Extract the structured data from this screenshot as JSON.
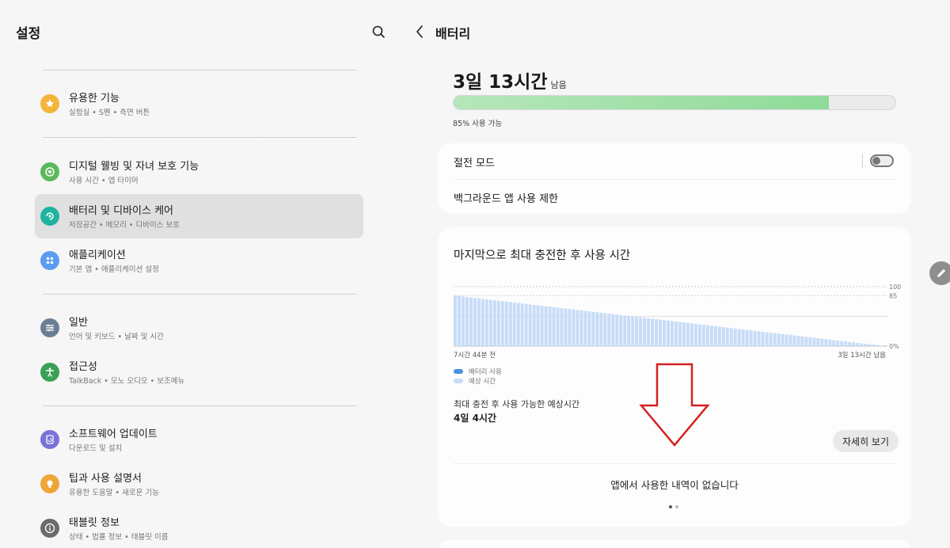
{
  "left": {
    "title": "설정",
    "items": [
      {
        "title": "유용한 기능",
        "sub": "실험실 • S펜 • 측면 버튼",
        "icon": "star-icon",
        "color": "#f3b63a"
      },
      {
        "title": "디지털 웰빙 및 자녀 보호 기능",
        "sub": "사용 시간 • 앱 타이머",
        "icon": "heart-icon",
        "color": "#5cb85c"
      },
      {
        "title": "배터리 및 디바이스 케어",
        "sub": "저장공간 • 메모리 • 디바이스 보호",
        "icon": "device-care-icon",
        "color": "#20b3a0"
      },
      {
        "title": "애플리케이션",
        "sub": "기본 앱 • 애플리케이션 설정",
        "icon": "apps-icon",
        "color": "#5b9bf0"
      },
      {
        "title": "일반",
        "sub": "언어 및 키보드 • 날짜 및 시간",
        "icon": "sliders-icon",
        "color": "#6b7f94"
      },
      {
        "title": "접근성",
        "sub": "TalkBack • 모노 오디오 • 보조메뉴",
        "icon": "accessibility-icon",
        "color": "#3aa055"
      },
      {
        "title": "소프트웨어 업데이트",
        "sub": "다운로드 및 설치",
        "icon": "update-icon",
        "color": "#7a72d8"
      },
      {
        "title": "팁과 사용 설명서",
        "sub": "유용한 도움말 • 새로운 기능",
        "icon": "bulb-icon",
        "color": "#f0a53a"
      },
      {
        "title": "태블릿 정보",
        "sub": "상태 • 법률 정보 • 태블릿 이름",
        "icon": "info-icon",
        "color": "#6b6b6b"
      }
    ]
  },
  "right": {
    "title": "배터리",
    "remaining_value": "3일 13시간",
    "remaining_suffix": "남음",
    "level_percent": 85,
    "level_label": "85% 사용 가능",
    "power_saving_label": "절전 모드",
    "power_saving_on": false,
    "background_limit_label": "백그라운드 앱 사용 제한",
    "usage_title": "마지막으로 최대 충전한 후 사용 시간",
    "legend_usage": "배터리 사용",
    "legend_estimate": "예상 시간",
    "estimate_label": "최대 충전 후 사용 가능한 예상시간",
    "estimate_value": "4일 4시간",
    "detail_button": "자세히 보기",
    "no_usage": "앱에서 사용한 내역이 없습니다"
  },
  "chart_data": {
    "type": "area",
    "x_labels": [
      "7시간 44분 전",
      "3일 13시간 남음"
    ],
    "y_ticks": [
      "100",
      "85",
      "0%"
    ],
    "ylim": [
      0,
      100
    ],
    "series": [
      {
        "name": "예상 시간",
        "values": [
          85,
          0
        ],
        "color": "#c7dcf7"
      }
    ],
    "colors": {
      "usage": "#4a90e2",
      "estimate": "#c7dcf7"
    }
  }
}
